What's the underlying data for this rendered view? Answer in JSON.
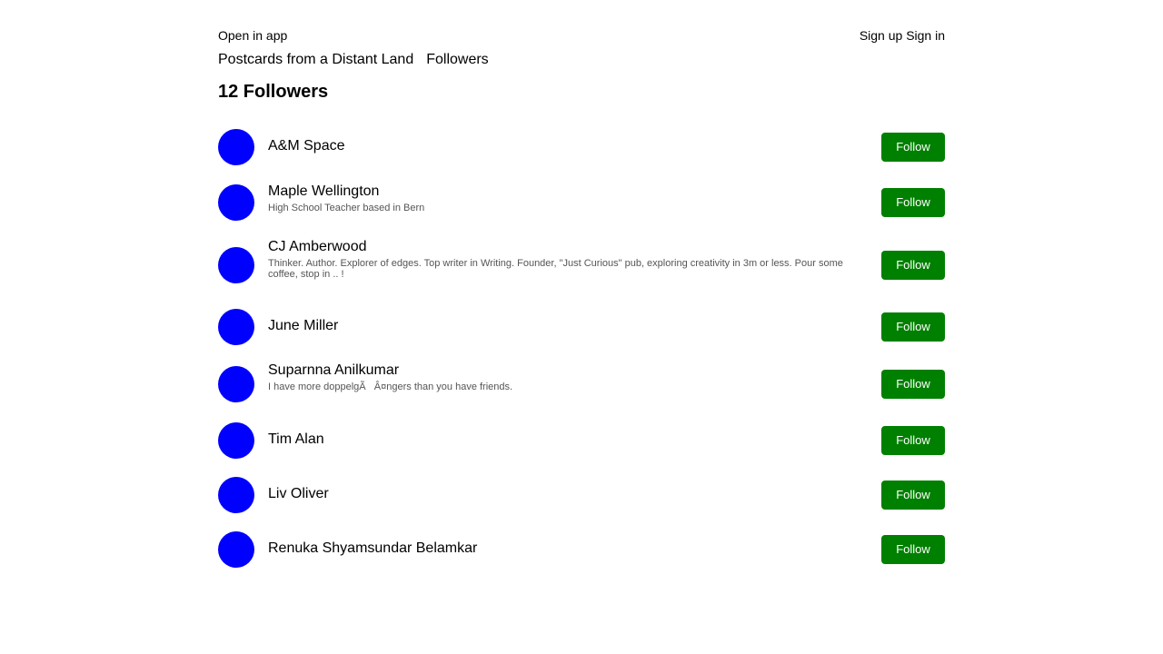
{
  "header": {
    "open_in_app": "Open in app",
    "sign_up": "Sign up",
    "sign_in": "Sign in"
  },
  "nav": {
    "publication": "Postcards from a Distant Land",
    "followers": "Followers"
  },
  "page": {
    "heading": "12 Followers"
  },
  "followers": [
    {
      "name": "A&M Space",
      "bio": "",
      "button": "Follow"
    },
    {
      "name": "Maple Wellington",
      "bio": "High School Teacher based in Bern",
      "button": "Follow"
    },
    {
      "name": "CJ Amberwood",
      "bio": "Thinker. Author. Explorer of edges. Top writer in Writing. Founder, \"Just Curious\" pub, exploring creativity in 3m or less. Pour some coffee, stop in .. !",
      "button": "Follow"
    },
    {
      "name": "June Miller",
      "bio": "",
      "button": "Follow"
    },
    {
      "name": "Suparnna Anilkumar",
      "bio": "I have more doppelgÃ   Â¤ngers than you have friends.",
      "button": "Follow"
    },
    {
      "name": "Tim Alan",
      "bio": "",
      "button": "Follow"
    },
    {
      "name": "Liv Oliver",
      "bio": "",
      "button": "Follow"
    },
    {
      "name": "Renuka Shyamsundar Belamkar",
      "bio": "",
      "button": "Follow"
    }
  ],
  "colors": {
    "avatar": "#0000ff",
    "follow_button": "#008000",
    "bio_text": "#555555"
  }
}
